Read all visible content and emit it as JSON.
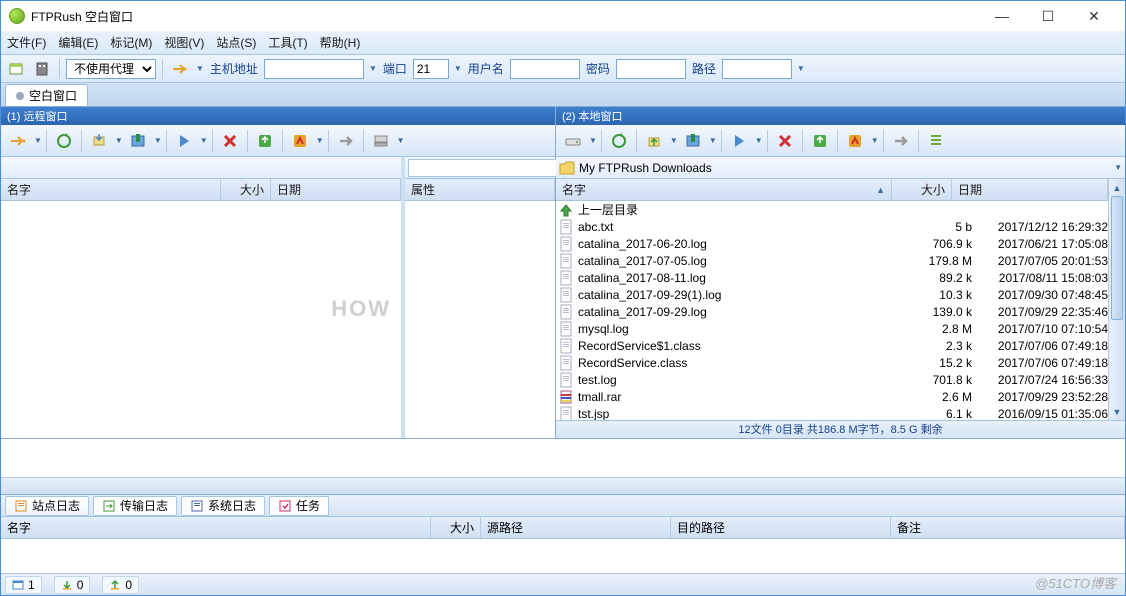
{
  "title": "FTPRush   空白窗口",
  "menu": [
    "文件(F)",
    "编辑(E)",
    "标记(M)",
    "视图(V)",
    "站点(S)",
    "工具(T)",
    "帮助(H)"
  ],
  "conn": {
    "proxy_label": "不使用代理",
    "host_label": "主机地址",
    "port_label": "端口",
    "port_value": "21",
    "user_label": "用户名",
    "pass_label": "密码",
    "path_label": "路径"
  },
  "maintab": "空白窗口",
  "remote": {
    "title": "(1) 远程窗口",
    "cols": {
      "name": "名字",
      "size": "大小",
      "date": "日期",
      "attr": "属性"
    },
    "watermark": "HOW"
  },
  "local": {
    "title": "(2) 本地窗口",
    "path": "My FTPRush Downloads",
    "cols": {
      "name": "名字",
      "size": "大小",
      "date": "日期"
    },
    "up": "上一层目录",
    "files": [
      {
        "n": "abc.txt",
        "s": "5 b",
        "d": "2017/12/12 16:29:32",
        "t": "txt"
      },
      {
        "n": "catalina_2017-06-20.log",
        "s": "706.9 k",
        "d": "2017/06/21 17:05:08",
        "t": "txt"
      },
      {
        "n": "catalina_2017-07-05.log",
        "s": "179.8 M",
        "d": "2017/07/05 20:01:53",
        "t": "txt"
      },
      {
        "n": "catalina_2017-08-11.log",
        "s": "89.2 k",
        "d": "2017/08/11 15:08:03",
        "t": "txt"
      },
      {
        "n": "catalina_2017-09-29(1).log",
        "s": "10.3 k",
        "d": "2017/09/30 07:48:45",
        "t": "txt"
      },
      {
        "n": "catalina_2017-09-29.log",
        "s": "139.0 k",
        "d": "2017/09/29 22:35:46",
        "t": "txt"
      },
      {
        "n": "mysql.log",
        "s": "2.8 M",
        "d": "2017/07/10 07:10:54",
        "t": "txt"
      },
      {
        "n": "RecordService$1.class",
        "s": "2.3 k",
        "d": "2017/07/06 07:49:18",
        "t": "txt"
      },
      {
        "n": "RecordService.class",
        "s": "15.2 k",
        "d": "2017/07/06 07:49:18",
        "t": "txt"
      },
      {
        "n": "test.log",
        "s": "701.8 k",
        "d": "2017/07/24 16:56:33",
        "t": "txt"
      },
      {
        "n": "tmall.rar",
        "s": "2.6 M",
        "d": "2017/09/29 23:52:28",
        "t": "rar"
      },
      {
        "n": "tst.jsp",
        "s": "6.1 k",
        "d": "2016/09/15 01:35:06",
        "t": "txt"
      }
    ],
    "status": "12文件 0目录 共186.8 M字节，8.5 G 剩余"
  },
  "logtabs": [
    "站点日志",
    "传输日志",
    "系统日志",
    "任务"
  ],
  "queue_cols": [
    "名字",
    "大小",
    "源路径",
    "目的路径",
    "备注"
  ],
  "status_counts": {
    "windows": "1",
    "down": "0",
    "up": "0"
  },
  "credit": "@51CTO博客"
}
